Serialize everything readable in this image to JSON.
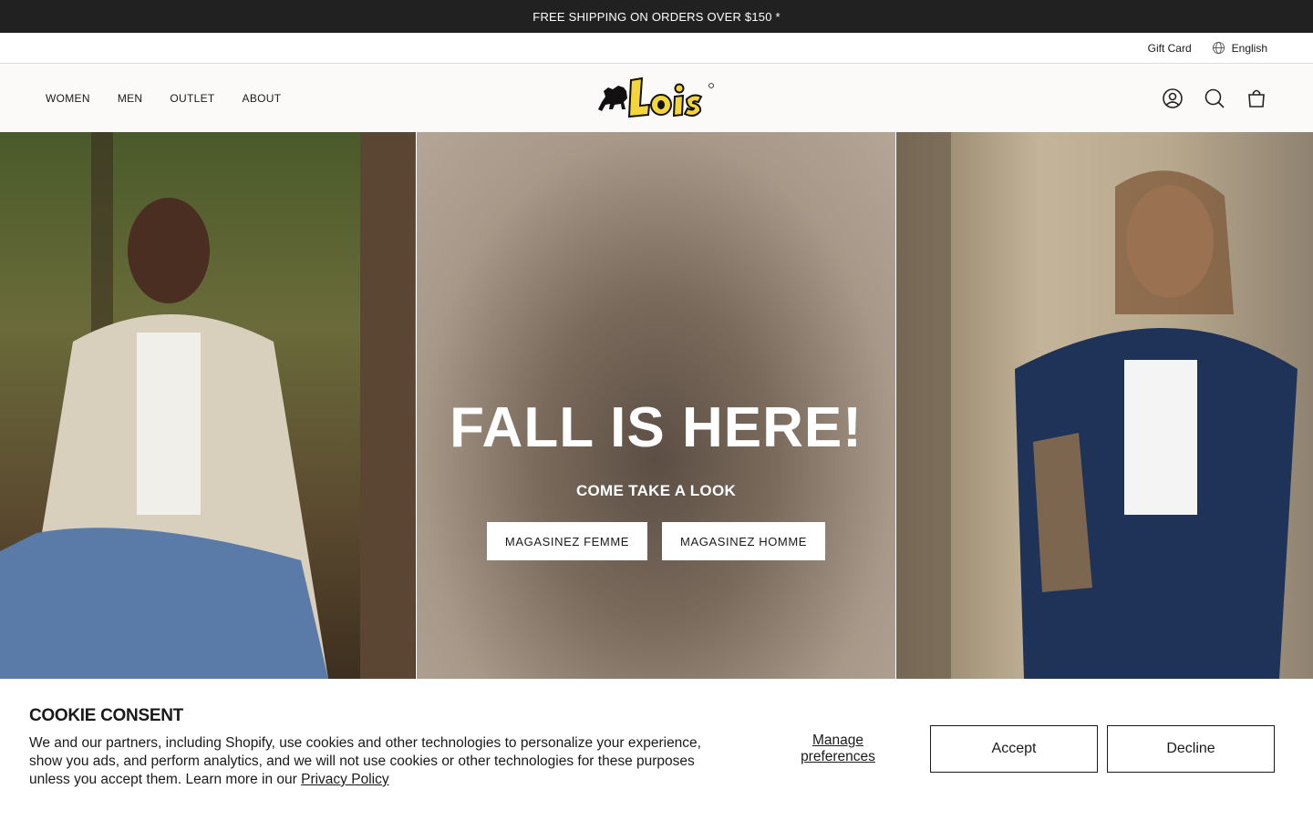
{
  "announcement": {
    "text": "FREE SHIPPING ON ORDERS OVER $150 *"
  },
  "utility": {
    "gift_card": "Gift Card",
    "language": "English"
  },
  "header": {
    "nav": [
      "WOMEN",
      "MEN",
      "OUTLET",
      "ABOUT"
    ],
    "logo_text": "Lois"
  },
  "hero": {
    "title": "FALL IS HERE!",
    "subtitle": "COME TAKE A LOOK",
    "buttons": [
      "MAGASINEZ FEMME",
      "MAGASINEZ HOMME"
    ]
  },
  "cookie": {
    "title": "COOKIE CONSENT",
    "body": "We and our partners, including Shopify, use cookies and other technologies to personalize your experience, show you ads, and perform analytics, and we will not use cookies or other technologies for these purposes unless you accept them. Learn more in our ",
    "policy_link": "Privacy Policy",
    "manage": "Manage preferences",
    "accept": "Accept",
    "decline": "Decline"
  },
  "colors": {
    "announcement_bg": "#212121",
    "logo_yellow": "#f5d63a",
    "header_bg": "#fbfaf8"
  }
}
